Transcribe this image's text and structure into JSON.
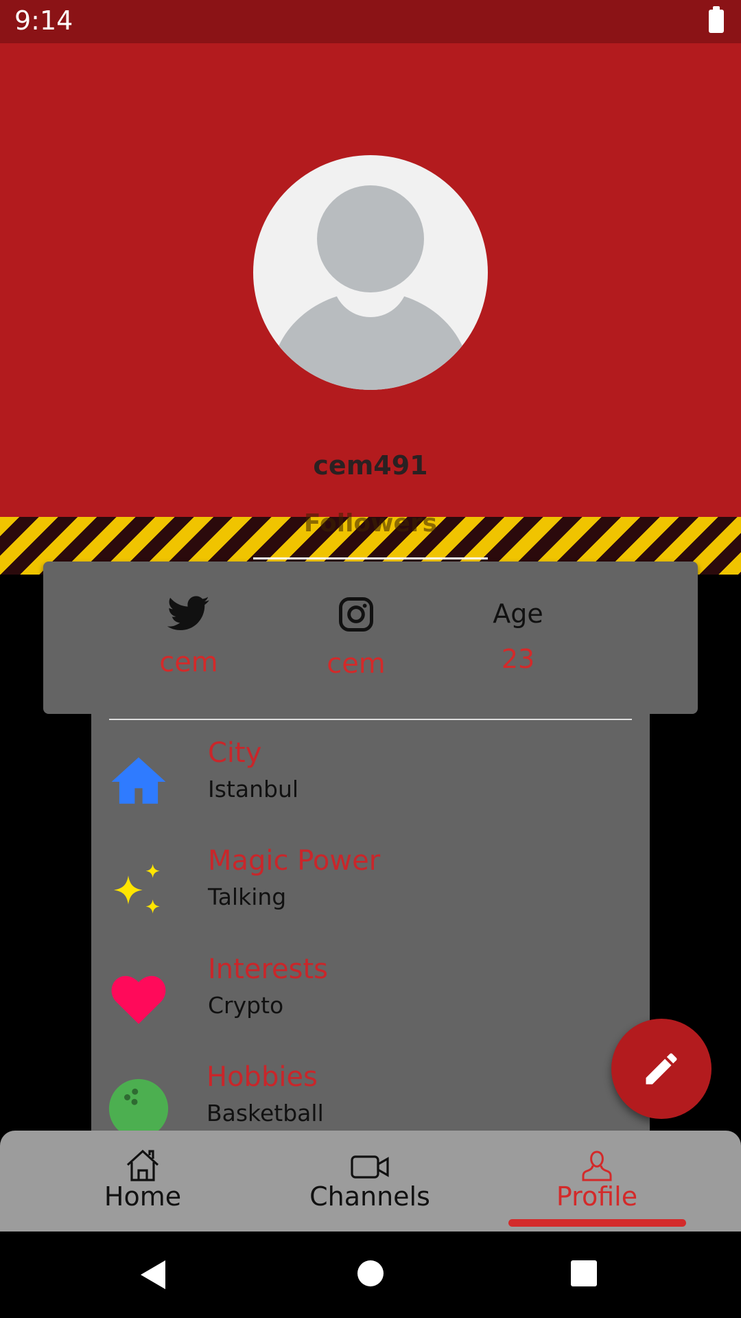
{
  "status_bar": {
    "time": "9:14"
  },
  "profile": {
    "username": "cem491",
    "followers_label": "Followers"
  },
  "info_card": {
    "twitter": {
      "icon": "twitter-icon",
      "value": "cem"
    },
    "instagram": {
      "icon": "instagram-icon",
      "value": "cem"
    },
    "age": {
      "label": "Age",
      "value": "23"
    }
  },
  "details": [
    {
      "icon": "house-icon",
      "title": "City",
      "value": "Istanbul"
    },
    {
      "icon": "sparkles-icon",
      "title": "Magic Power",
      "value": "Talking"
    },
    {
      "icon": "heart-icon",
      "title": "Interests",
      "value": "Crypto"
    },
    {
      "icon": "bowling-ball-icon",
      "title": "Hobbies",
      "value": "Basketball"
    }
  ],
  "fab": {
    "icon": "pencil-icon"
  },
  "bottom_nav": [
    {
      "label": "Home",
      "icon": "home-icon"
    },
    {
      "label": "Channels",
      "icon": "video-camera-icon"
    },
    {
      "label": "Profile",
      "icon": "user-icon",
      "active": true
    }
  ],
  "colors": {
    "header": "#b31b1e",
    "status_bar": "#8b1316",
    "accent_text": "#d32a2a",
    "card": "#646464",
    "bottom_nav": "#9c9c9c",
    "stripe_yellow": "#f0c400",
    "stripe_dark": "#2b0a0c"
  }
}
